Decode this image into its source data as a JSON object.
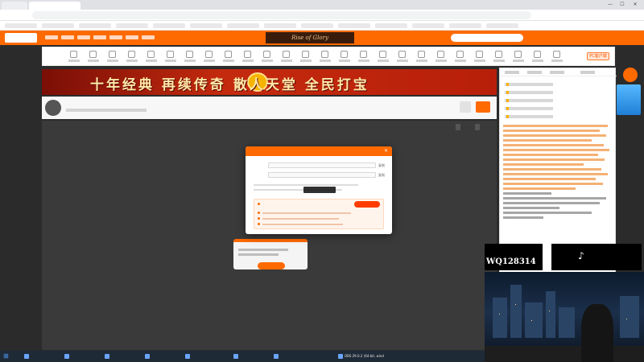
{
  "browser": {
    "active_tab_title": "",
    "url": "",
    "window_controls": [
      "—",
      "☐",
      "✕"
    ]
  },
  "overlay_captions": {
    "line1": "",
    "line2": ""
  },
  "site": {
    "game_logo": "Rise of Glory",
    "pc_client_label": "PC客户端"
  },
  "banner": {
    "left_text": "",
    "main_text": "十年经典 再续传奇 散人天堂 全民打宝"
  },
  "room": {
    "title": ""
  },
  "player": {
    "pills": [
      "",
      ""
    ]
  },
  "modal": {
    "title": "",
    "close": "✕",
    "fields": [
      {
        "label": "",
        "value": "",
        "copy": "复制"
      },
      {
        "label": "",
        "value": "",
        "copy": "复制"
      }
    ],
    "toast": "",
    "tool": {
      "title": "",
      "button": ""
    }
  },
  "overlay": {
    "qun_line1": "",
    "qun_line2": "WQ128314",
    "tiktok_icon": "♪",
    "tiktok_name": ""
  },
  "taskbar": {
    "start_icon": "⊞",
    "apps": [
      "",
      "",
      "",
      "",
      "",
      "",
      "",
      "OBS 29.0.2 (64-bit, wind"
    ]
  },
  "icons": [
    "search-icon",
    "close-icon",
    "tiktok-icon",
    "windows-start-icon"
  ],
  "colors": {
    "brand": "#ff6a00",
    "caption": "#f5d400"
  }
}
